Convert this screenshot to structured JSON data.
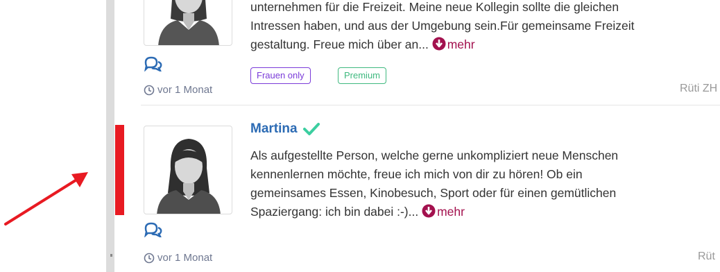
{
  "listing1": {
    "description_line0": "unternehmen für die Freizeit. Meine neue Kollegin sollte die gleichen",
    "description_line1": "Intressen haben, und aus der Umgebung sein.Für gemeinsame Freizeit",
    "description_line2": "gestaltung. Freue mich über an...",
    "more_label": "mehr",
    "tags": [
      "Frauen only",
      "Premium"
    ],
    "time": "vor 1 Monat",
    "location": "Rüti ZH"
  },
  "listing2": {
    "name": "Martina",
    "description_line1": "Als aufgestellte Person, welche gerne unkompliziert neue Menschen",
    "description_line2": "kennenlernen möchte, freue ich mich von dir zu hören! Ob ein",
    "description_line3": "gemeinsames Essen, Kinobesuch, Sport oder für einen gemütlichen",
    "description_line4": "Spaziergang: ich bin dabei :-)...",
    "more_label": "mehr",
    "time": "vor 1 Monat",
    "location": "Rüt"
  },
  "colors": {
    "name": "#2c6bb4",
    "verified": "#3ccea0",
    "more": "#a3114e",
    "tag_women": "#7a3bd9",
    "tag_premium": "#3fb97f",
    "annotation": "#e81a22"
  },
  "icons": [
    "chat-icon",
    "clock-icon",
    "arrow-down-circle-icon",
    "verified-check-icon",
    "avatar-placeholder"
  ]
}
